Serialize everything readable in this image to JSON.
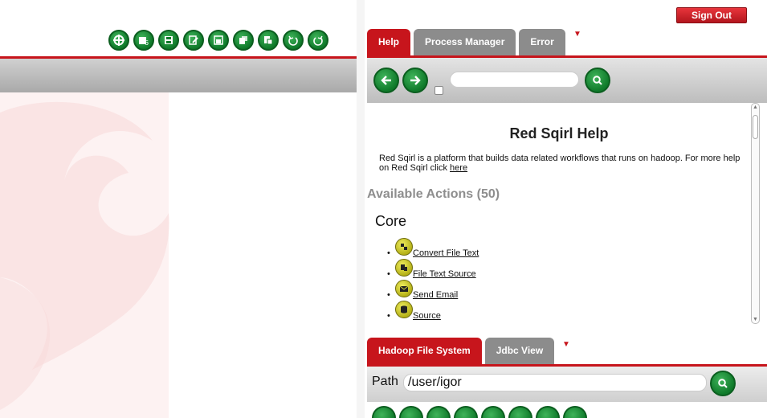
{
  "header": {
    "signout_label": "Sign Out"
  },
  "canvas_toolbar": {
    "buttons": [
      {
        "icon": "crosshair-icon"
      },
      {
        "icon": "open-file-icon"
      },
      {
        "icon": "save-icon"
      },
      {
        "icon": "edit-icon"
      },
      {
        "icon": "save-as-icon"
      },
      {
        "icon": "copy-icon"
      },
      {
        "icon": "paste-icon"
      },
      {
        "icon": "undo-icon"
      },
      {
        "icon": "redo-icon"
      }
    ]
  },
  "help_panel": {
    "tabs": [
      {
        "label": "Help",
        "active": true
      },
      {
        "label": "Process Manager",
        "active": false
      },
      {
        "label": "Error",
        "active": false
      }
    ],
    "search": {
      "value": "",
      "placeholder": ""
    },
    "title": "Red Sqirl Help",
    "description": "Red Sqirl is a platform that builds data related workflows that runs on hadoop. For more help on Red Sqirl click ",
    "description_link": "here",
    "available_actions": "Available Actions (50)",
    "category": "Core",
    "actions": [
      {
        "label": "Convert File Text",
        "icon": "convert-file-icon"
      },
      {
        "label": "File Text Source",
        "icon": "file-source-icon"
      },
      {
        "label": "Send Email",
        "icon": "email-icon"
      },
      {
        "label": "Source",
        "icon": "database-icon"
      }
    ]
  },
  "fs_panel": {
    "tabs": [
      {
        "label": "Hadoop File System",
        "active": true
      },
      {
        "label": "Jdbc View",
        "active": false
      }
    ],
    "path_label": "Path",
    "path_value": "/user/igor"
  },
  "colors": {
    "brand_red": "#c7151c",
    "button_green": "#0f7a2a",
    "inactive_tab": "#8c8c8c",
    "action_icon": "#d6d43a"
  }
}
